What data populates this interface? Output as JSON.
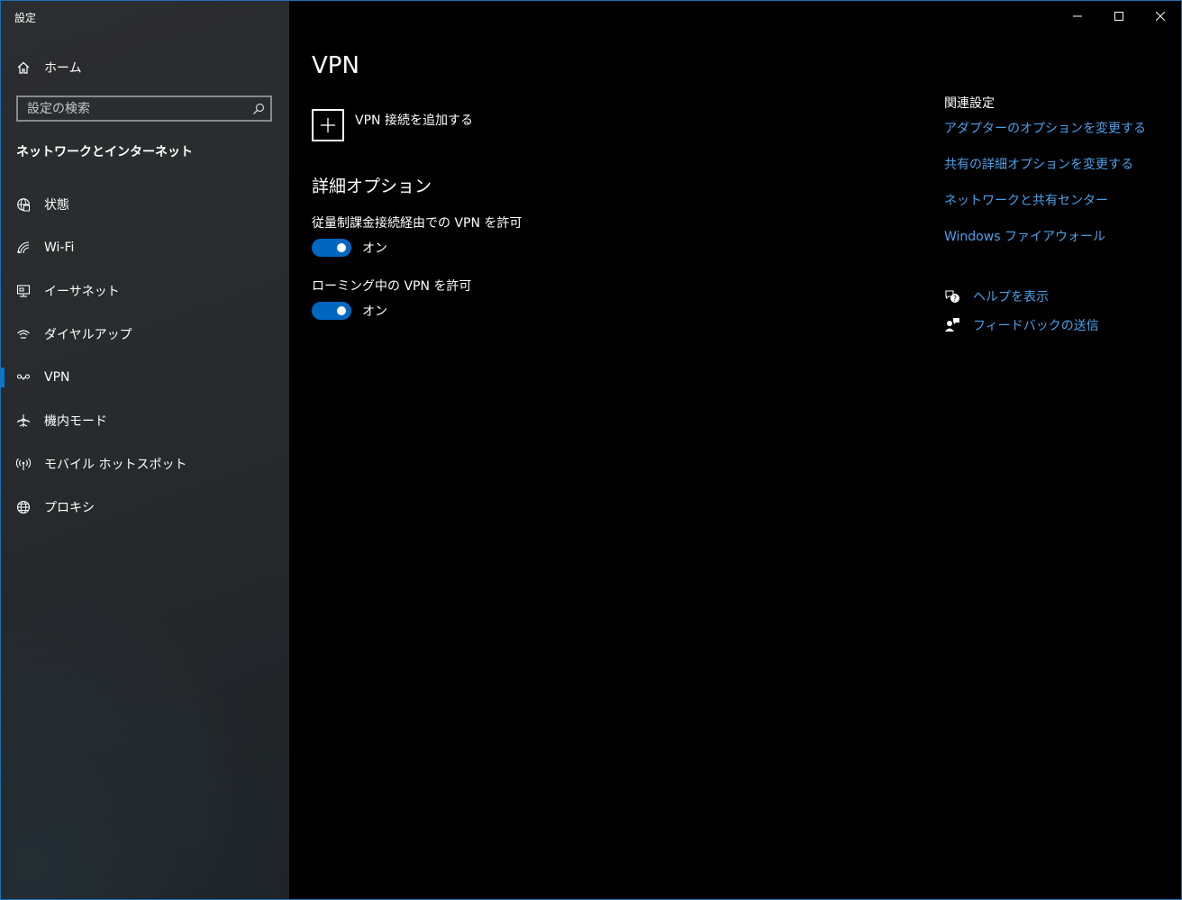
{
  "window": {
    "title": "設定",
    "controls": {
      "minimize": "minimize-icon",
      "maximize": "maximize-icon",
      "close": "close-icon"
    }
  },
  "sidebar": {
    "home_label": "ホーム",
    "search": {
      "placeholder": "設定の検索",
      "value": ""
    },
    "section_title": "ネットワークとインターネット",
    "items": [
      {
        "label": "状態",
        "icon": "globe-status-icon"
      },
      {
        "label": "Wi-Fi",
        "icon": "wifi-icon"
      },
      {
        "label": "イーサネット",
        "icon": "ethernet-icon"
      },
      {
        "label": "ダイヤルアップ",
        "icon": "dialup-icon"
      },
      {
        "label": "VPN",
        "icon": "vpn-icon",
        "selected": true
      },
      {
        "label": "機内モード",
        "icon": "airplane-icon"
      },
      {
        "label": "モバイル ホットスポット",
        "icon": "hotspot-icon"
      },
      {
        "label": "プロキシ",
        "icon": "globe-icon"
      }
    ]
  },
  "main": {
    "title": "VPN",
    "add_vpn_label": "VPN 接続を追加する",
    "advanced_heading": "詳細オプション",
    "settings": [
      {
        "label": "従量制課金接続経由での VPN を許可",
        "state": "オン",
        "on": true
      },
      {
        "label": "ローミング中の VPN を許可",
        "state": "オン",
        "on": true
      }
    ]
  },
  "related": {
    "title": "関連設定",
    "links": [
      "アダプターのオプションを変更する",
      "共有の詳細オプションを変更する",
      "ネットワークと共有センター",
      "Windows ファイアウォール"
    ],
    "help_label": "ヘルプを表示",
    "feedback_label": "フィードバックの送信"
  },
  "colors": {
    "accent": "#0078d7",
    "toggle_on": "#0067c0",
    "link": "#4ba0e8",
    "background": "#000000"
  }
}
